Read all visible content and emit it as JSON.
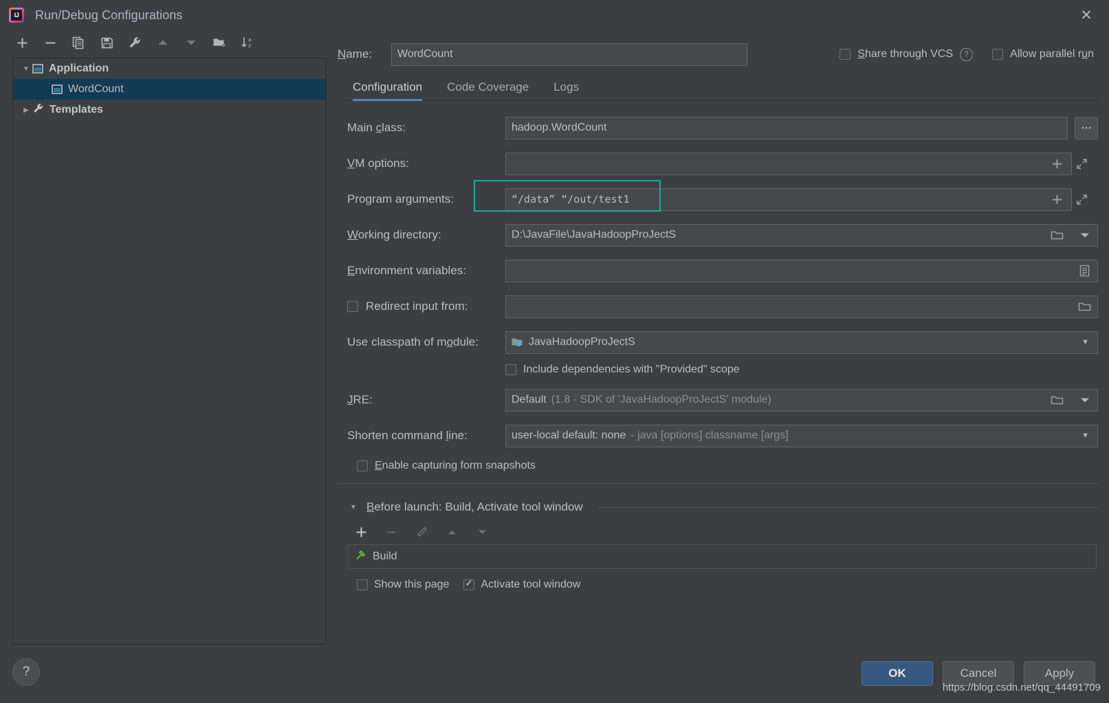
{
  "window": {
    "title": "Run/Debug Configurations",
    "logo_icon": "intellij-idea-logo",
    "close_icon": "close-icon"
  },
  "left_panel": {
    "toolbar": [
      {
        "name": "add-configuration-button",
        "icon": "plus-icon",
        "label": "+"
      },
      {
        "name": "remove-configuration-button",
        "icon": "minus-icon",
        "label": "−"
      },
      {
        "name": "copy-configuration-button",
        "icon": "copy-icon",
        "label": ""
      },
      {
        "name": "save-configuration-button",
        "icon": "save-icon",
        "label": ""
      },
      {
        "name": "edit-templates-button",
        "icon": "wrench-icon",
        "label": ""
      },
      {
        "name": "move-up-button",
        "icon": "arrow-up-icon",
        "label": ""
      },
      {
        "name": "move-down-button",
        "icon": "arrow-down-icon",
        "label": ""
      },
      {
        "name": "new-folder-button",
        "icon": "folder-add-icon",
        "label": ""
      },
      {
        "name": "sort-configurations-button",
        "icon": "sort-az-icon",
        "label": ""
      }
    ],
    "tree": [
      {
        "label": "Application",
        "icon": "application-icon",
        "expanded": true,
        "selected": false,
        "level": 0,
        "arrow": "▼"
      },
      {
        "label": "WordCount",
        "icon": "application-icon",
        "expanded": false,
        "selected": true,
        "level": 1,
        "arrow": ""
      },
      {
        "label": "Templates",
        "icon": "wrench-icon",
        "expanded": false,
        "selected": false,
        "level": 0,
        "arrow": "▶"
      }
    ],
    "help_button": {
      "label": "?",
      "icon": "question-mark-icon"
    }
  },
  "name_row": {
    "label": "Name:",
    "value": "WordCount",
    "share_vcs": {
      "label": "Share through VCS",
      "checked": false,
      "help_icon": "question-circle-icon"
    },
    "allow_parallel": {
      "label": "Allow parallel run",
      "checked": false
    }
  },
  "tabs": [
    {
      "label": "Configuration",
      "active": true
    },
    {
      "label": "Code Coverage",
      "active": false
    },
    {
      "label": "Logs",
      "active": false
    }
  ],
  "form": {
    "main_class": {
      "label": "Main class:",
      "value": "hadoop.WordCount",
      "browse_label": "...",
      "browse_icon": "ellipsis-icon"
    },
    "vm_options": {
      "label": "VM options:",
      "value": "",
      "add_icon": "plus-icon",
      "expand_icon": "expand-arrows-icon"
    },
    "program_arguments": {
      "label": "Program arguments:",
      "value": "“/data” “/out/test1",
      "add_icon": "plus-icon",
      "expand_icon": "expand-arrows-icon",
      "highlight_color": "#1aa9a0",
      "highlighted": true
    },
    "working_directory": {
      "label": "Working directory:",
      "value": "D:\\JavaFile\\JavaHadoopProJectS",
      "folder_icon": "folder-icon",
      "dropdown_icon": "chevron-down-icon"
    },
    "environment_variables": {
      "label": "Environment variables:",
      "value": "",
      "edit_icon": "list-edit-icon"
    },
    "redirect_input": {
      "label": "Redirect input from:",
      "checked": false,
      "value": "",
      "folder_icon": "folder-icon"
    },
    "use_classpath_of_module": {
      "label": "Use classpath of module:",
      "value": "JavaHadoopProJectS",
      "module_icon": "module-icon",
      "dropdown_icon": "chevron-down-icon"
    },
    "include_provided": {
      "label": "Include dependencies with \"Provided\" scope",
      "checked": false
    },
    "jre": {
      "label": "JRE:",
      "value": "Default",
      "value_detail": "(1.8 - SDK of 'JavaHadoopProJectS' module)",
      "folder_icon": "folder-icon",
      "dropdown_icon": "chevron-down-icon"
    },
    "shorten_command_line": {
      "label": "Shorten command line:",
      "value": "user-local default: none",
      "value_detail": "- java [options] classname [args]",
      "dropdown_icon": "chevron-down-icon"
    },
    "enable_form_snapshots": {
      "label": "Enable capturing form snapshots",
      "checked": false
    }
  },
  "before_launch": {
    "header": "Before launch: Build, Activate tool window",
    "collapse_arrow": "▼",
    "toolbar": [
      {
        "name": "before-launch-add-button",
        "icon": "plus-icon",
        "label": "+",
        "enabled": true
      },
      {
        "name": "before-launch-remove-button",
        "icon": "minus-icon",
        "label": "−",
        "enabled": false
      },
      {
        "name": "before-launch-edit-button",
        "icon": "pencil-icon",
        "label": "",
        "enabled": false
      },
      {
        "name": "before-launch-move-up-button",
        "icon": "arrow-up-icon",
        "label": "",
        "enabled": false
      },
      {
        "name": "before-launch-move-down-button",
        "icon": "arrow-down-icon",
        "label": "",
        "enabled": false
      }
    ],
    "tasks": [
      {
        "label": "Build",
        "icon": "build-hammer-icon"
      }
    ],
    "show_this_page": {
      "label": "Show this page",
      "checked": false
    },
    "activate_tool_window": {
      "label": "Activate tool window",
      "checked": true
    }
  },
  "footer": {
    "ok": "OK",
    "cancel": "Cancel",
    "apply": "Apply"
  },
  "watermark": "https://blog.csdn.net/qq_44491709"
}
